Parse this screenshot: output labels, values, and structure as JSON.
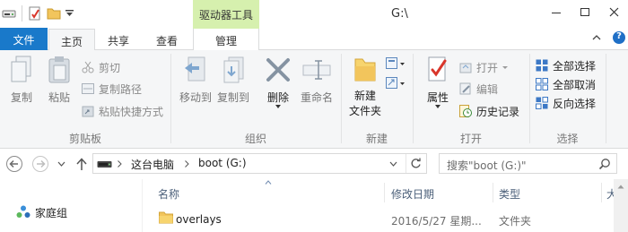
{
  "window": {
    "title": "G:\\",
    "contextual_tab_group": "驱动器工具"
  },
  "tabs": {
    "file": "文件",
    "home": "主页",
    "share": "共享",
    "view": "查看",
    "manage": "管理"
  },
  "ribbon": {
    "clipboard": {
      "label": "剪贴板",
      "copy": "复制",
      "paste": "粘贴",
      "cut": "剪切",
      "copy_path": "复制路径",
      "paste_shortcut": "粘贴快捷方式"
    },
    "organize": {
      "label": "组织",
      "move_to": "移动到",
      "copy_to": "复制到",
      "delete": "删除",
      "rename": "重命名"
    },
    "new": {
      "label": "新建",
      "new_folder": "新建\n文件夹"
    },
    "open": {
      "label": "打开",
      "properties": "属性",
      "open": "打开",
      "edit": "编辑",
      "history": "历史记录"
    },
    "select": {
      "label": "选择",
      "select_all": "全部选择",
      "select_none": "全部取消",
      "invert": "反向选择"
    }
  },
  "address": {
    "crumbs": [
      "这台电脑",
      "boot (G:)"
    ],
    "search_placeholder": "搜索\"boot (G:)\""
  },
  "nav_pane": {
    "homegroup": "家庭组"
  },
  "columns": {
    "name": "名称",
    "modified": "修改日期",
    "type": "类型",
    "size": "大"
  },
  "files": [
    {
      "name": "overlays",
      "modified": "2016/5/27 星期...",
      "type": "文件夹"
    }
  ],
  "colors": {
    "accent": "#1979ca",
    "contextual": "#d6f0ae",
    "folder": "#f2c55c"
  }
}
